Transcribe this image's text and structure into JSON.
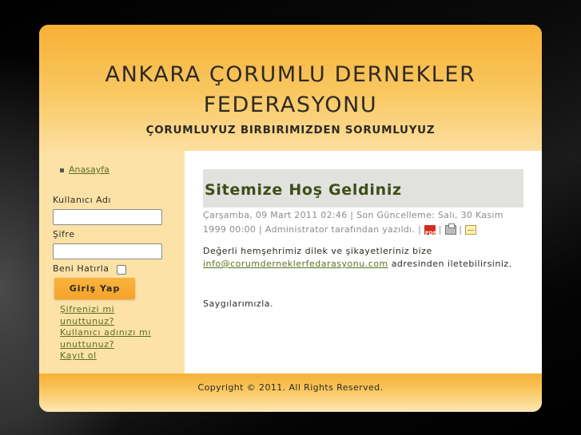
{
  "header": {
    "title_line1": "ANKARA ÇORUMLU DERNEKLER",
    "title_line2": "FEDERASYONU",
    "slogan": "ÇORUMLUYUZ BIRBIRIMIZDEN SORUMLUYUZ"
  },
  "sidebar": {
    "menu": [
      {
        "label": "Anasayfa"
      }
    ],
    "login": {
      "username_label": "Kullanıcı Adı",
      "username_value": "",
      "password_label": "Şifre",
      "password_value": "",
      "remember_label": "Beni Hatırla",
      "remember_checked": false,
      "submit_label": "Giriş Yap",
      "forgot_password_line1": "Şifrenizi mi",
      "forgot_password_line2": "unuttunuz?",
      "forgot_username_line1": "Kullanıcı adınızı mı",
      "forgot_username_line2": "unuttunuz?",
      "register_label": "Kayıt ol"
    }
  },
  "article": {
    "title": "Sitemize Hoş Geldiniz",
    "created": "Çarşamba, 09 Mart 2011 02:46",
    "separator": "|",
    "updated": "Son Güncelleme: Salı, 30 Kasım 1999 00:00",
    "author": "Administrator tarafından yazıldı.",
    "icons": [
      "pdf-icon",
      "print-icon",
      "email-icon"
    ],
    "pdf_icon_text": "PDF",
    "body_text": "Değerli hemşehrimiz dilek ve şikayetleriniz bize",
    "email_link": "info@corumderneklerfedarasyonu.com",
    "body_text_after": "adresinden iletebilirsiniz.",
    "closing": "Saygılarımızla."
  },
  "footer": {
    "copyright": "Copyright © 2011. All Rights Reserved."
  },
  "colors": {
    "header_orange": "#f7b035",
    "sidebar_bg": "#fde2a8",
    "link_green": "#5a6f1f",
    "title_green": "#3d4d18"
  }
}
